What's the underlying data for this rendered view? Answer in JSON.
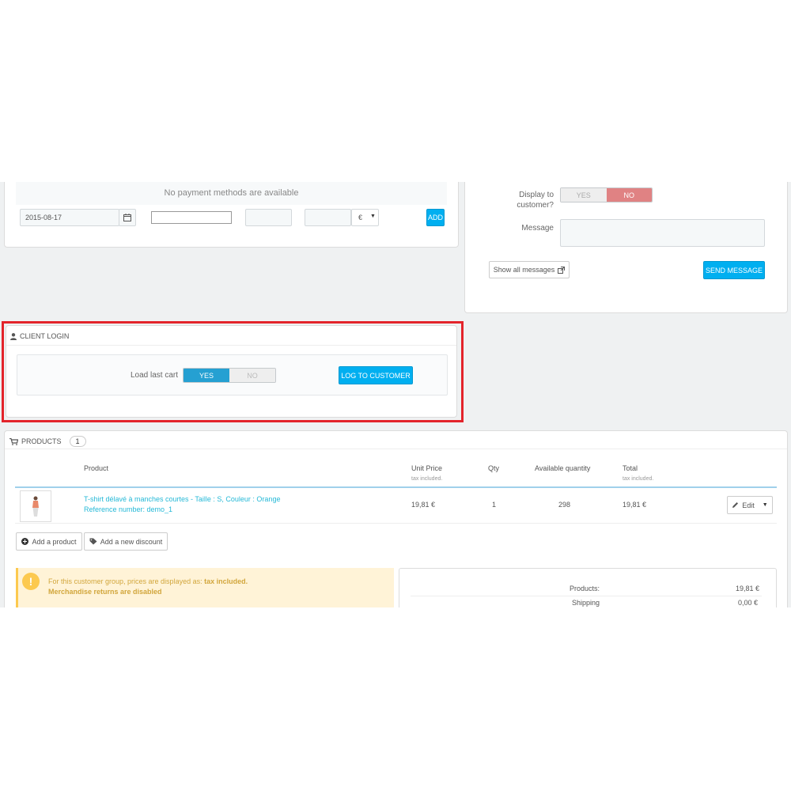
{
  "payment": {
    "empty_text": "No payment methods are available",
    "date_value": "2015-08-17",
    "currency_value": "€",
    "add_label": "ADD"
  },
  "messages": {
    "display_label_line1": "Display to",
    "display_label_line2": "customer?",
    "toggle_yes": "YES",
    "toggle_no": "NO",
    "message_label": "Message",
    "show_all_label": "Show all messages",
    "send_label": "SEND MESSAGE"
  },
  "client_login": {
    "title": "CLIENT LOGIN",
    "load_last_cart_label": "Load last cart",
    "toggle_yes": "YES",
    "toggle_no": "NO",
    "log_button": "LOG TO CUSTOMER",
    "highlight_color": "#e3242b"
  },
  "products": {
    "title": "PRODUCTS",
    "count": "1",
    "columns": {
      "product": "Product",
      "unit_price": "Unit Price",
      "unit_price_sub": "tax included.",
      "qty": "Qty",
      "available": "Available quantity",
      "total": "Total",
      "total_sub": "tax included."
    },
    "rows": [
      {
        "name": "T-shirt délavé à manches courtes - Taille : S, Couleur : Orange",
        "reference": "Reference number: demo_1",
        "unit_price": "19,81 €",
        "qty": "1",
        "available": "298",
        "total": "19,81 €",
        "edit_label": "Edit"
      }
    ],
    "add_product_label": "Add a product",
    "add_discount_label": "Add a new discount"
  },
  "notice": {
    "line1_prefix": "For this customer group, prices are displayed as:",
    "line1_strong": "tax included.",
    "line2": "Merchandise returns are disabled"
  },
  "totals": {
    "products_label": "Products:",
    "products_value": "19,81 €",
    "shipping_label": "Shipping",
    "shipping_value": "0,00 €"
  }
}
